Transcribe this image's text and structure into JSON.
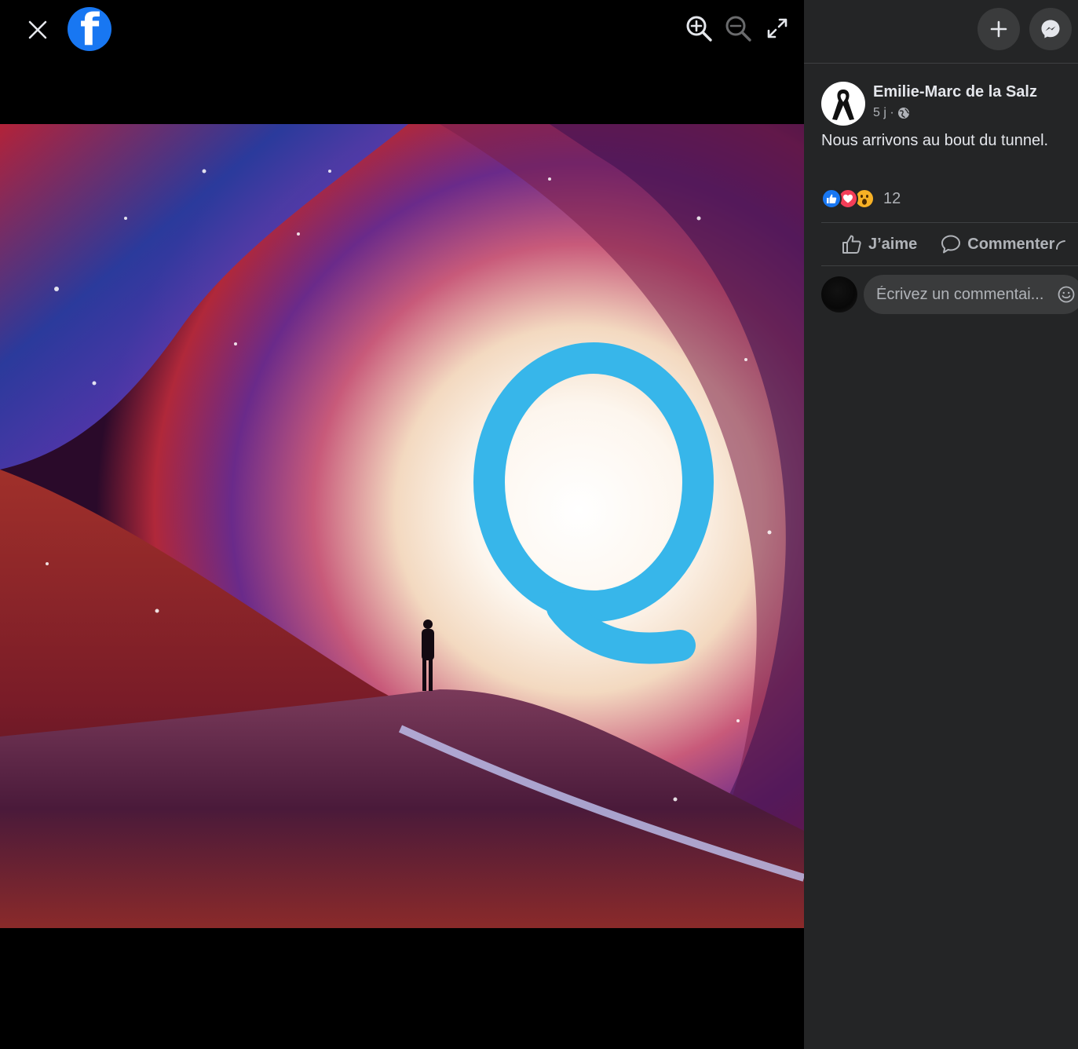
{
  "post": {
    "author": "Emilie-Marc de la Salz",
    "time": "5 j ·",
    "text": "Nous arrivons au bout du tunnel.",
    "reaction_count": "12"
  },
  "actions": {
    "like_label": "J’aime",
    "comment_label": "Commenter"
  },
  "comment": {
    "placeholder": "Écrivez un commentai..."
  },
  "colors": {
    "brand": "#1877f2",
    "panel_bg": "#242526",
    "button_bg": "#3a3b3c",
    "text_primary": "#e4e6eb",
    "text_secondary": "#b0b3b8"
  },
  "icons": {
    "close": "close-icon",
    "logo": "facebook-logo-icon",
    "zoom_in": "zoom-in-icon",
    "zoom_out": "zoom-out-icon",
    "fullscreen": "fullscreen-icon",
    "create": "plus-icon",
    "messenger": "messenger-icon",
    "audience": "globe-icon",
    "like": "thumbs-up-icon",
    "comment": "speech-bubble-icon",
    "emoji": "smiley-icon"
  }
}
